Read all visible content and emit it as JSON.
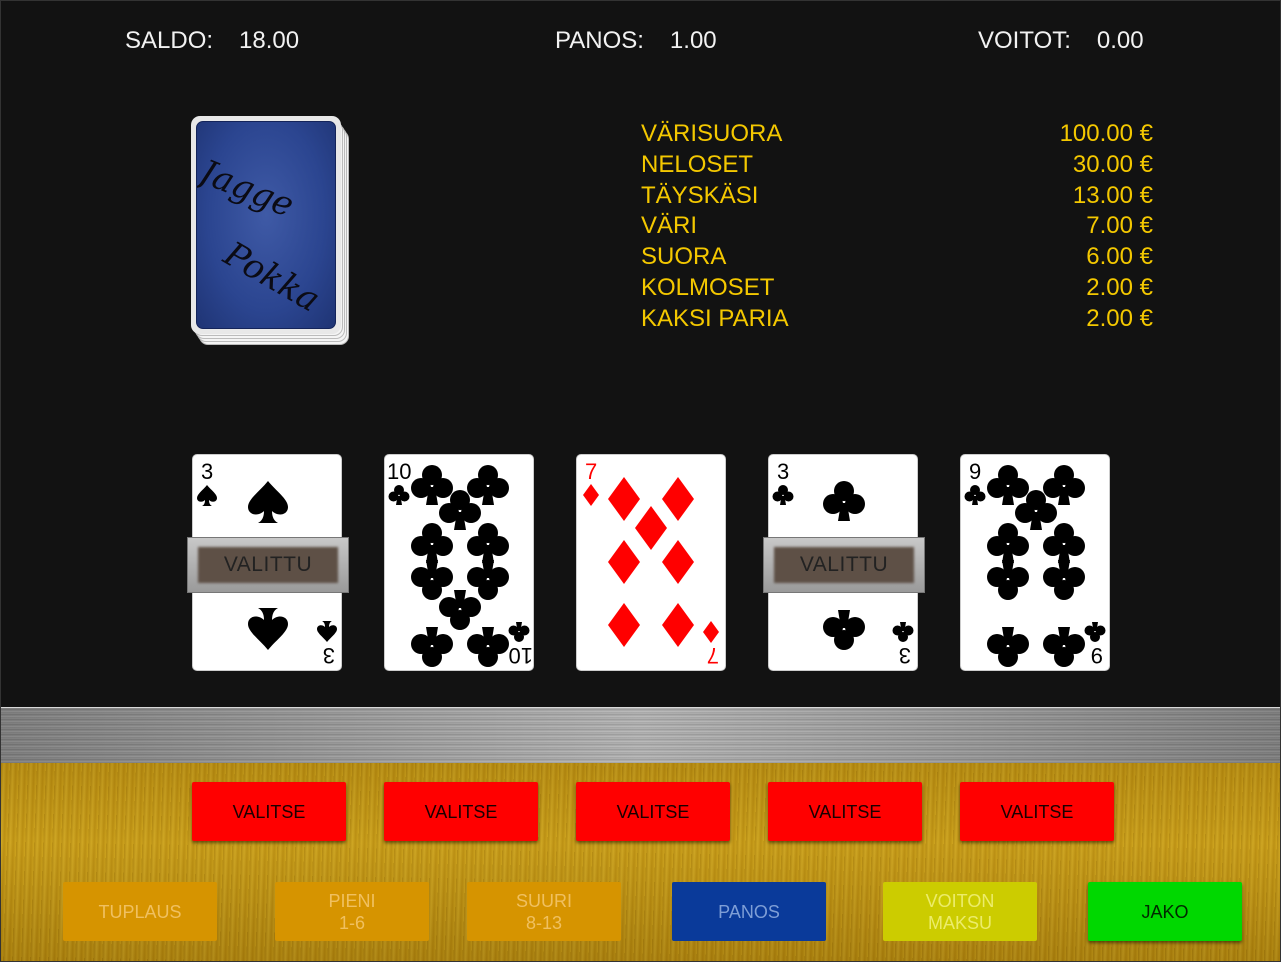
{
  "stats": {
    "saldo_label": "SALDO:",
    "saldo_value": "18.00",
    "panos_label": "PANOS:",
    "panos_value": "1.00",
    "voitot_label": "VOITOT:",
    "voitot_value": "0.00"
  },
  "deck": {
    "text_line_1": "Jagge",
    "text_line_2": "Pokka"
  },
  "paytable": [
    {
      "name": "VÄRISUORA",
      "amount": "100.00 €"
    },
    {
      "name": "NELOSET",
      "amount": "30.00 €"
    },
    {
      "name": "TÄYSKÄSI",
      "amount": "13.00 €"
    },
    {
      "name": "VÄRI",
      "amount": "7.00 €"
    },
    {
      "name": "SUORA",
      "amount": "6.00 €"
    },
    {
      "name": "KOLMOSET",
      "amount": "2.00 €"
    },
    {
      "name": "KAKSI PARIA",
      "amount": "2.00 €"
    }
  ],
  "cards": [
    {
      "rank": "3",
      "suit": "spades",
      "held": true
    },
    {
      "rank": "10",
      "suit": "clubs",
      "held": false
    },
    {
      "rank": "7",
      "suit": "diamonds",
      "held": false
    },
    {
      "rank": "3",
      "suit": "clubs",
      "held": true
    },
    {
      "rank": "9",
      "suit": "clubs",
      "held": false
    }
  ],
  "held_label": "VALITTU",
  "select_buttons": [
    "VALITSE",
    "VALITSE",
    "VALITSE",
    "VALITSE",
    "VALITSE"
  ],
  "buttons": {
    "tuplaus": "TUPLAUS",
    "pieni_line1": "PIENI",
    "pieni_line2": "1-6",
    "suuri_line1": "SUURI",
    "suuri_line2": "8-13",
    "panos": "PANOS",
    "voiton_line1": "VOITON",
    "voiton_line2": "MAKSU",
    "jako": "JAKO"
  },
  "colors": {
    "paytable_text": "#f4c800",
    "select_button": "#ff0000",
    "deal_button": "#00d800",
    "bet_button": "#0a3a9a",
    "suit_red": "#ff0000",
    "suit_black": "#000000"
  }
}
